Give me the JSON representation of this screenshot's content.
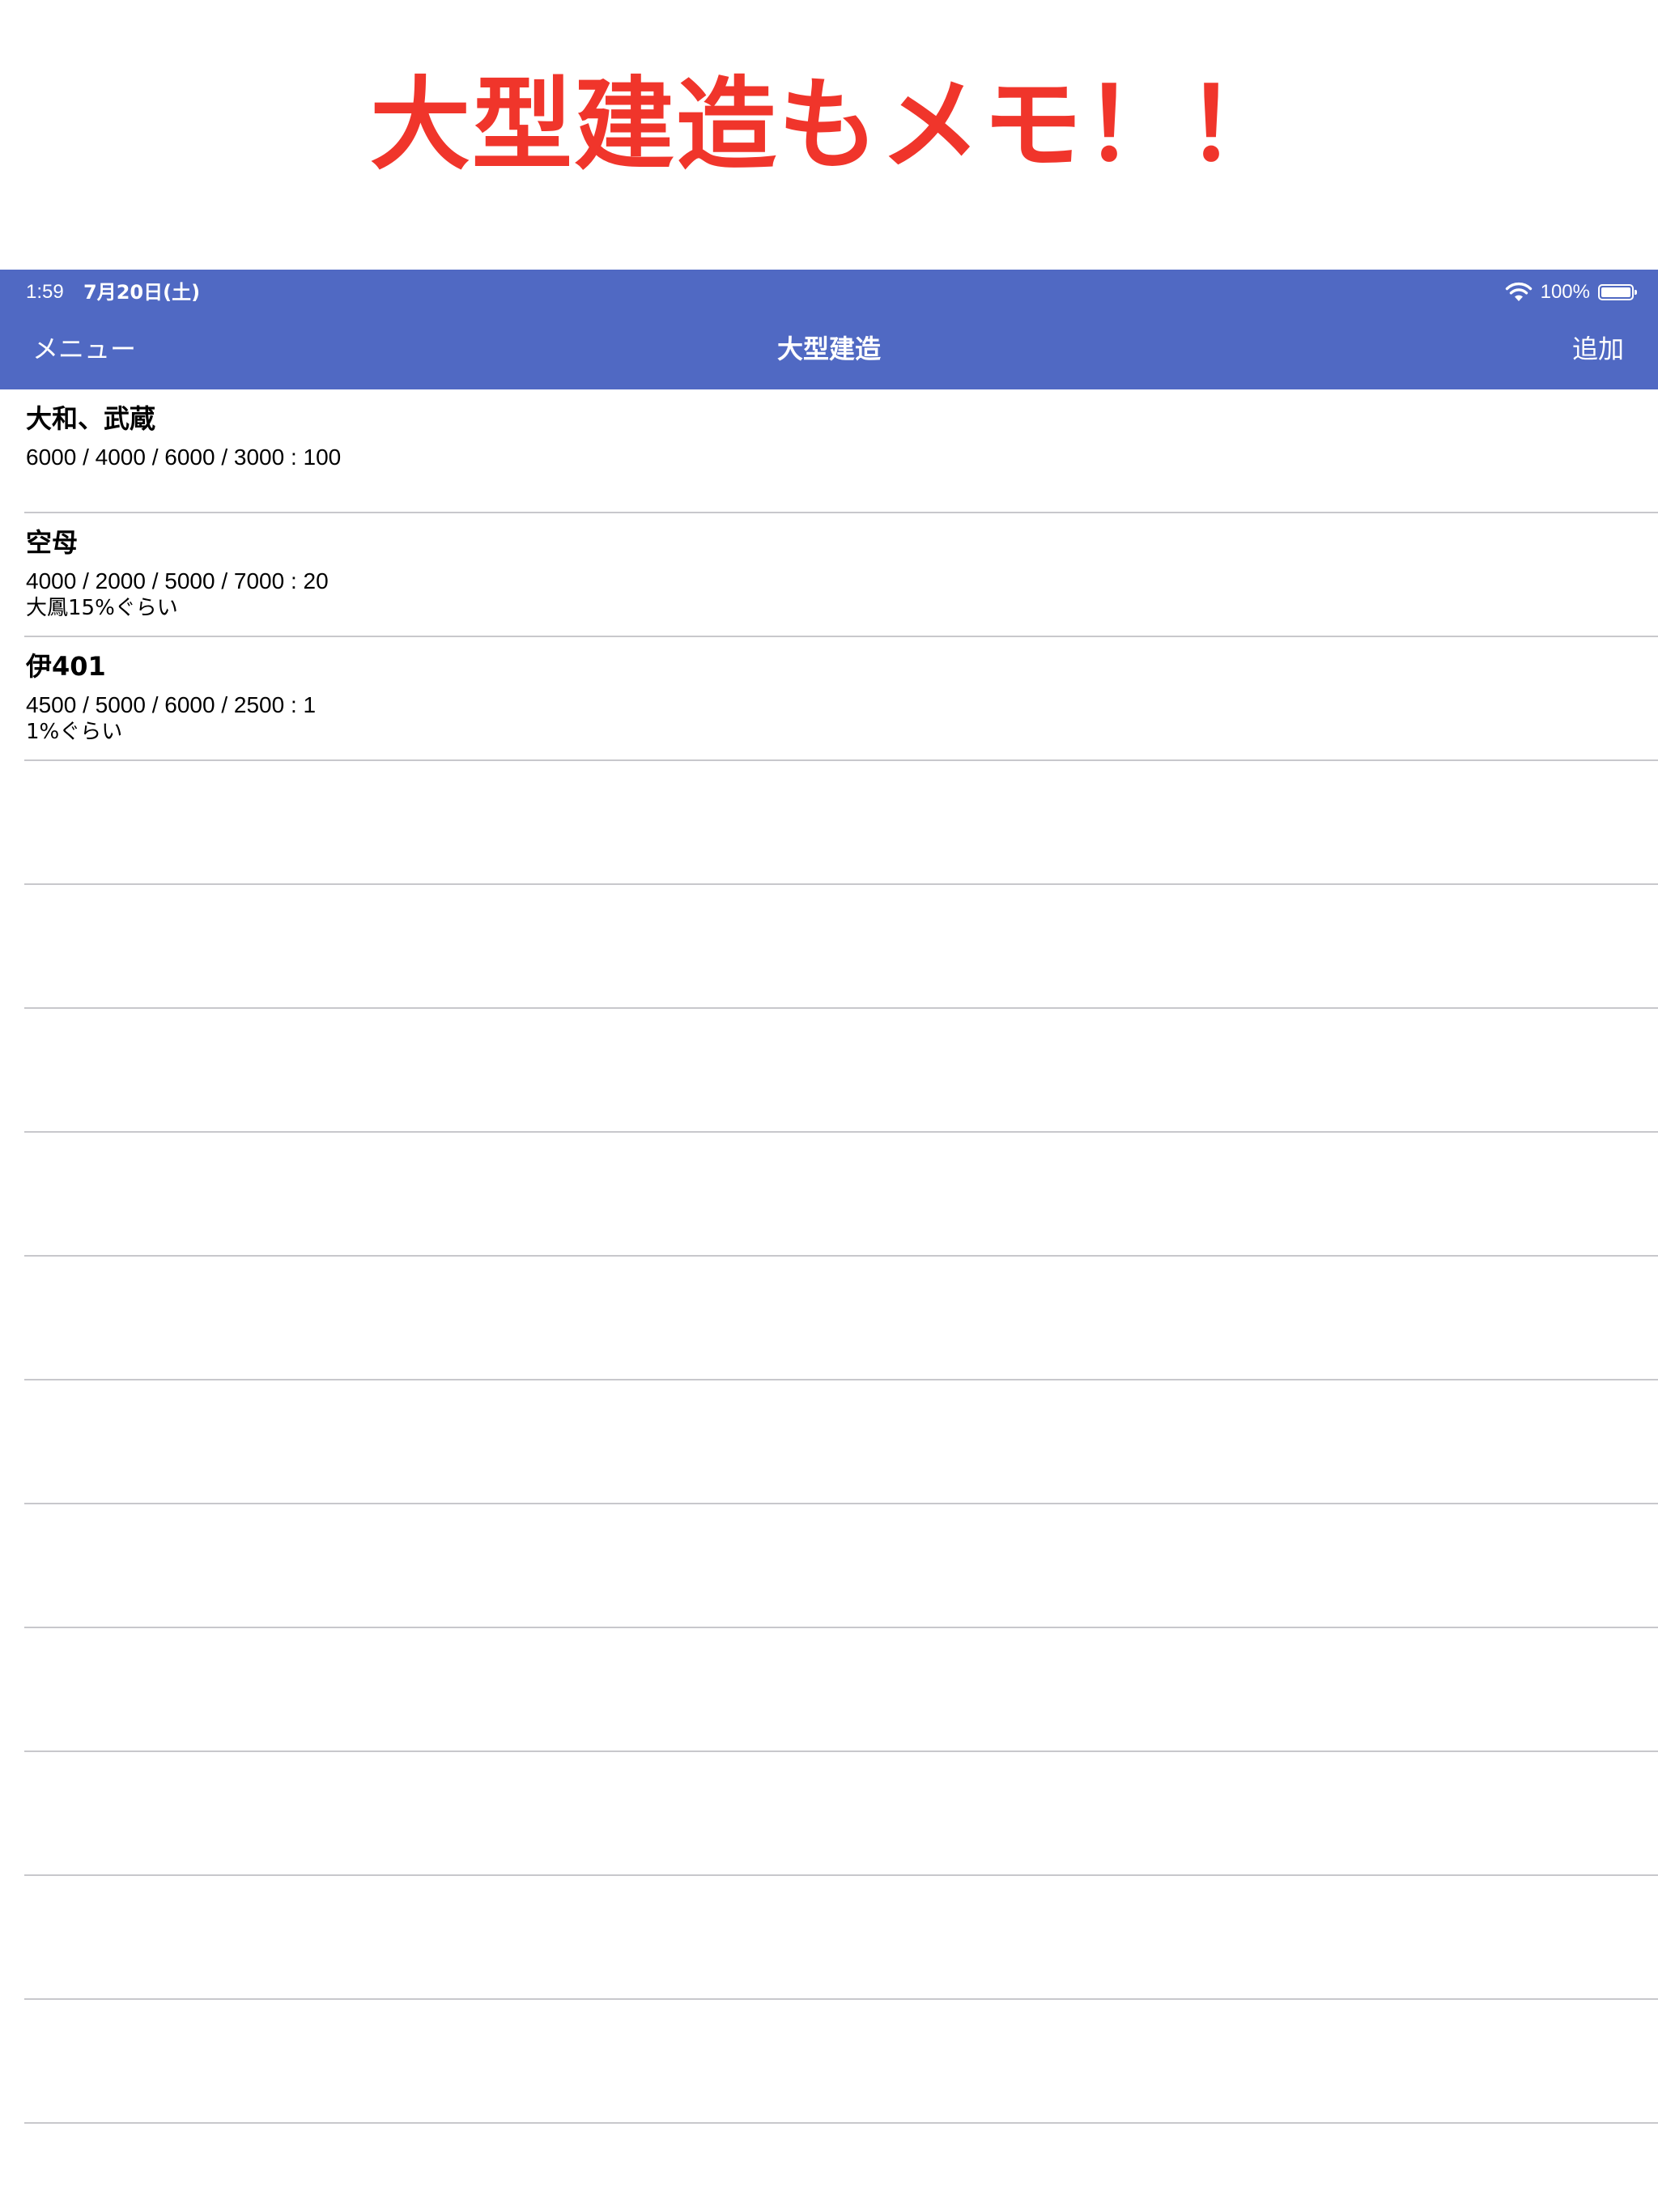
{
  "promo": {
    "headline": "大型建造もメモ！！"
  },
  "status_bar": {
    "time": "1:59",
    "date": "7月20日(土)",
    "battery": "100%",
    "wifi_icon": "wifi-icon",
    "battery_icon": "battery-icon"
  },
  "nav": {
    "left_button": "メニュー",
    "title": "大型建造",
    "right_button": "追加",
    "background_color": "#5069c3"
  },
  "colors": {
    "headline": "#f0352b",
    "nav_background": "#5069c3",
    "separator": "#c8c8cc"
  },
  "recipes": [
    {
      "name": "大和、武蔵",
      "values": "6000 / 4000 / 6000 / 3000 : 100",
      "note": ""
    },
    {
      "name": "空母",
      "values": "4000 / 2000 / 5000 / 7000 : 20",
      "note": "大鳳15%ぐらい"
    },
    {
      "name": "伊401",
      "values": "4500 / 5000 / 6000 / 2500 : 1",
      "note": "1%ぐらい"
    }
  ]
}
